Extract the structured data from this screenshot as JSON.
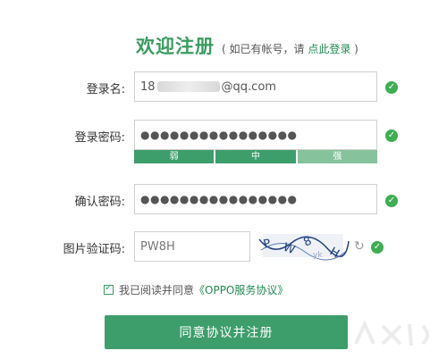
{
  "header": {
    "title": "欢迎注册",
    "subtitle_prefix": "( 如已有帐号，请 ",
    "login_link": "点此登录",
    "subtitle_suffix": " )"
  },
  "form": {
    "username_label": "登录名:",
    "username_prefix": "18",
    "username_suffix": "@qq.com",
    "password_label": "登录密码:",
    "password_value": "●●●●●●●●●●●●●●●●",
    "strength_weak": "弱",
    "strength_medium": "中",
    "strength_strong": "强",
    "confirm_label": "确认密码:",
    "confirm_value": "●●●●●●●●●●●●●●●●",
    "captcha_label": "图片验证码:",
    "captcha_value": "PW8H"
  },
  "agreement": {
    "text": "我已阅读并同意",
    "link": "《OPPO服务协议》"
  },
  "submit_label": "同意协议并注册",
  "colors": {
    "accent": "#3a9c5f",
    "strength_weak": "#3d9e6b",
    "strength_medium": "#3d9e6b",
    "strength_strong": "#86c29c",
    "check": "#3fae52"
  }
}
